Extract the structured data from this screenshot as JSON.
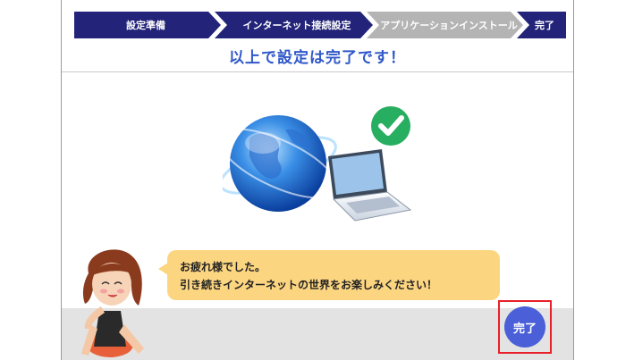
{
  "steps": {
    "items": [
      {
        "label": "設定準備"
      },
      {
        "label": "インターネット接続設定"
      },
      {
        "label": "アプリケーションインストール"
      },
      {
        "label": "完了"
      }
    ]
  },
  "heading": "以上で設定は完了です！",
  "message": {
    "line1": "お疲れ様でした。",
    "line2": "引き続きインターネットの世界をお楽しみください！"
  },
  "done_button": "完了",
  "colors": {
    "step_active": "#23237a",
    "step_inactive": "#b4b4b4",
    "heading": "#2f58c8",
    "bubble": "#fcd581",
    "done_button": "#4a5fd8",
    "highlight": "#e8202a",
    "check": "#27ae60"
  },
  "icons": [
    "globe-icon",
    "laptop-icon",
    "checkmark-icon"
  ]
}
